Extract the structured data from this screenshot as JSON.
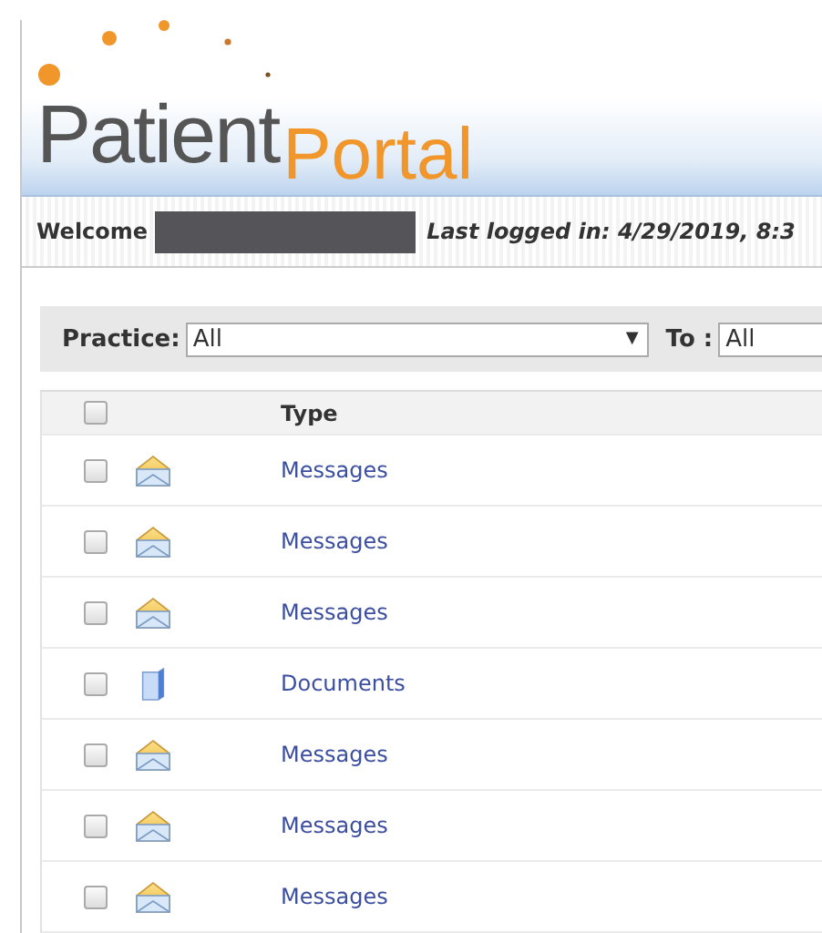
{
  "logo": {
    "first": "Patient",
    "second": "Portal"
  },
  "welcome": {
    "label": "Welcome",
    "last_login": "Last logged in: 4/29/2019, 8:3"
  },
  "filters": [
    {
      "label": "Practice:",
      "value": "All",
      "arrow": "▼"
    },
    {
      "label": "To :",
      "value": "All"
    }
  ],
  "table": {
    "header_checked": false,
    "columns": [
      "Type"
    ],
    "rows": [
      {
        "kind": "message",
        "type": "Messages",
        "checked": false
      },
      {
        "kind": "message",
        "type": "Messages",
        "checked": false
      },
      {
        "kind": "message",
        "type": "Messages",
        "checked": false
      },
      {
        "kind": "document",
        "type": "Documents",
        "checked": false
      },
      {
        "kind": "message",
        "type": "Messages",
        "checked": false
      },
      {
        "kind": "message",
        "type": "Messages",
        "checked": false
      },
      {
        "kind": "message",
        "type": "Messages",
        "checked": false
      }
    ]
  }
}
